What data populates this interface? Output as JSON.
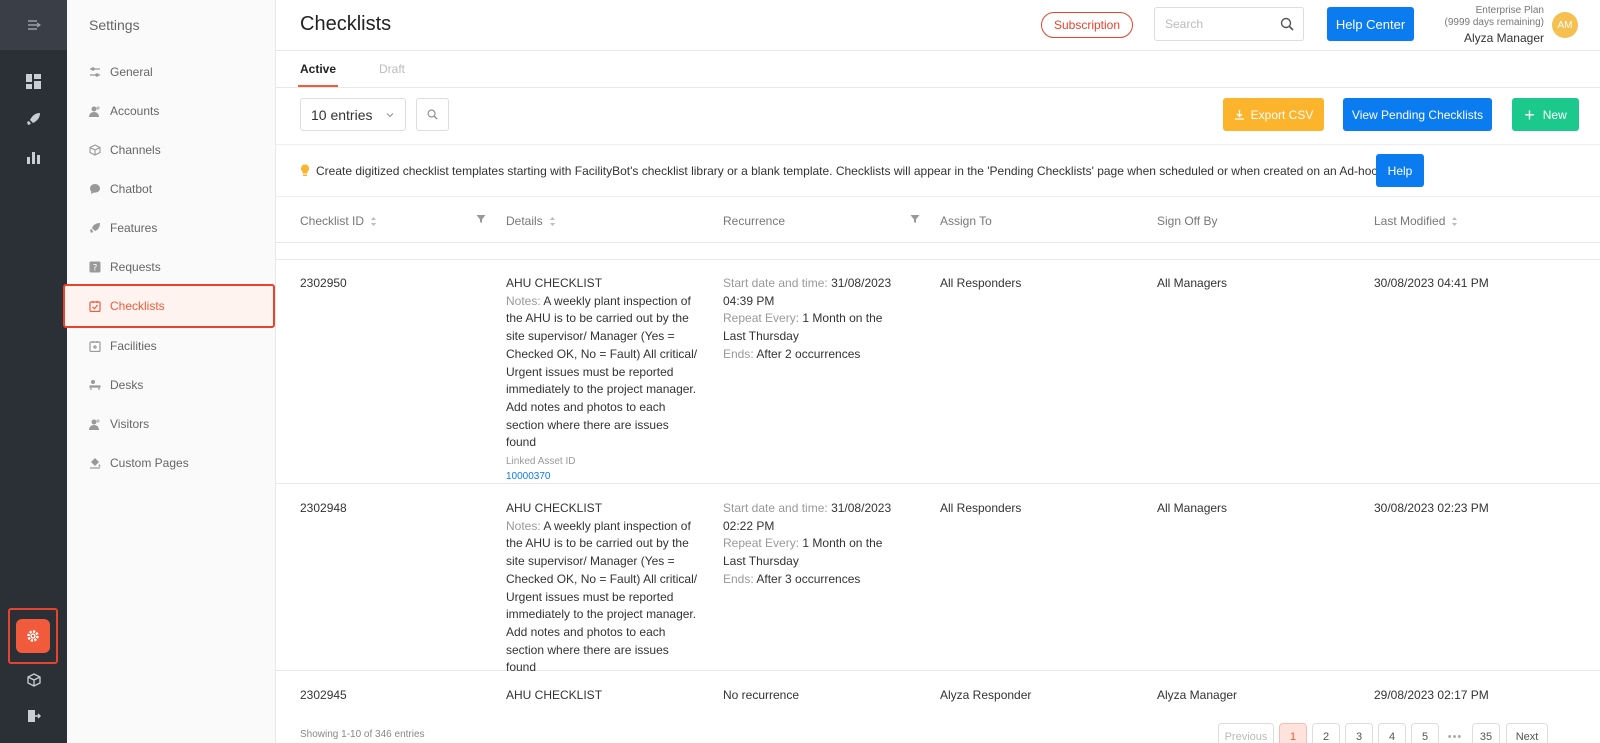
{
  "app": {
    "section_title": "Settings"
  },
  "sidebar": {
    "items": [
      {
        "label": "General",
        "icon": "sliders-icon"
      },
      {
        "label": "Accounts",
        "icon": "users-icon"
      },
      {
        "label": "Channels",
        "icon": "cube-icon"
      },
      {
        "label": "Chatbot",
        "icon": "chat-icon"
      },
      {
        "label": "Features",
        "icon": "rocket-icon"
      },
      {
        "label": "Requests",
        "icon": "question-icon"
      },
      {
        "label": "Checklists",
        "icon": "checklist-icon",
        "active": true
      },
      {
        "label": "Facilities",
        "icon": "calendar-plus-icon"
      },
      {
        "label": "Desks",
        "icon": "desk-icon"
      },
      {
        "label": "Visitors",
        "icon": "visitor-icon"
      },
      {
        "label": "Custom Pages",
        "icon": "paint-bucket-icon"
      }
    ]
  },
  "header": {
    "title": "Checklists",
    "subscription_label": "Subscription",
    "search_placeholder": "Search",
    "help_center_label": "Help Center",
    "plan_name": "Enterprise Plan",
    "plan_remaining": "(9999 days remaining)",
    "user_name": "Alyza Manager",
    "avatar_initials": "AM"
  },
  "tabs": [
    {
      "label": "Active",
      "active": true
    },
    {
      "label": "Draft"
    }
  ],
  "toolbar": {
    "entries_value": "10 entries",
    "export_label": "Export CSV",
    "pending_label": "View Pending Checklists",
    "new_label": "New"
  },
  "info": {
    "text": "Create digitized checklist templates starting with FacilityBot's checklist library or a blank template. Checklists will appear in the 'Pending Checklists' page when scheduled or when created on an Ad-hoc basis.",
    "help_label": "Help"
  },
  "table": {
    "columns": [
      "Checklist ID",
      "Details",
      "Recurrence",
      "Assign To",
      "Sign Off By",
      "Last Modified"
    ],
    "rows": [
      {
        "id": "2302950",
        "title": "AHU CHECKLIST",
        "notes_label": "Notes:",
        "notes": "A weekly plant inspection of the AHU is to be carried out by the site supervisor/ Manager (Yes = Checked OK, No = Fault) All critical/ Urgent issues must be reported immediately to the project manager. Add notes and photos to each section where there are issues found",
        "asset_label": "Linked Asset ID",
        "asset_id": "10000370",
        "start_label": "Start date and time:",
        "start_value": "31/08/2023 04:39 PM",
        "repeat_label": "Repeat Every:",
        "repeat_value": "1 Month on the Last Thursday",
        "ends_label": "Ends:",
        "ends_value": "After 2 occurrences",
        "assign_to": "All Responders",
        "sign_off_by": "All Managers",
        "last_modified": "30/08/2023 04:41 PM"
      },
      {
        "id": "2302948",
        "title": "AHU CHECKLIST",
        "notes_label": "Notes:",
        "notes": "A weekly plant inspection of the AHU is to be carried out by the site supervisor/ Manager (Yes = Checked OK, No = Fault) All critical/ Urgent issues must be reported immediately to the project manager. Add notes and photos to each section where there are issues found",
        "start_label": "Start date and time:",
        "start_value": "31/08/2023 02:22 PM",
        "repeat_label": "Repeat Every:",
        "repeat_value": "1 Month on the Last Thursday",
        "ends_label": "Ends:",
        "ends_value": "After 3 occurrences",
        "assign_to": "All Responders",
        "sign_off_by": "All Managers",
        "last_modified": "30/08/2023 02:23 PM"
      },
      {
        "id": "2302945",
        "title": "AHU CHECKLIST",
        "recurrence": "No recurrence",
        "assign_to": "Alyza Responder",
        "sign_off_by": "Alyza Manager",
        "last_modified": "29/08/2023 02:17 PM"
      }
    ]
  },
  "footer": {
    "showing": "Showing 1-10 of 346 entries",
    "previous": "Previous",
    "pages": [
      "1",
      "2",
      "3",
      "4",
      "5"
    ],
    "dots": "•••",
    "last_page": "35",
    "next": "Next"
  },
  "colors": {
    "accent": "#f15a3a",
    "primary": "#0b7cf0",
    "export": "#fbb42c",
    "new": "#1cc98c",
    "rail": "#2b2f36"
  }
}
